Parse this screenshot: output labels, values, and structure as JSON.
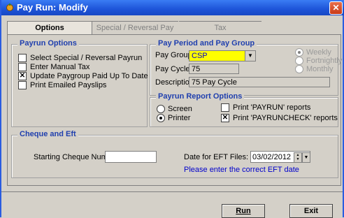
{
  "window": {
    "title": "Pay Run: Modify",
    "close_label": "✕"
  },
  "tabs": [
    {
      "label": "Options",
      "active": true
    },
    {
      "label": "Special / Reversal Pay",
      "active": false
    },
    {
      "label": "Tax",
      "active": false
    }
  ],
  "payrun_options": {
    "legend": "Payrun Options",
    "items": [
      {
        "label": "Select Special / Reversal Payrun",
        "checked": false
      },
      {
        "label": "Enter Manual Tax",
        "checked": false
      },
      {
        "label": "Update Paygroup Paid Up To Date",
        "checked": true
      },
      {
        "label": "Print Emailed Payslips",
        "checked": false
      }
    ]
  },
  "pay_period": {
    "legend": "Pay Period and Pay Group",
    "pay_group_label": "Pay Group:",
    "pay_group_value": "CSP",
    "pay_cycle_label": "Pay Cycle:",
    "pay_cycle_value": "75",
    "description_label": "Description:",
    "description_value": "75 Pay Cycle",
    "frequency": [
      {
        "label": "Weekly",
        "selected": true
      },
      {
        "label": "Fortnightly",
        "selected": false
      },
      {
        "label": "Monthly",
        "selected": false
      }
    ]
  },
  "report_options": {
    "legend": "Payrun Report Options",
    "outputs": [
      {
        "label": "Screen",
        "selected": false
      },
      {
        "label": "Printer",
        "selected": true
      }
    ],
    "reports": [
      {
        "label": "Print 'PAYRUN' reports",
        "checked": false
      },
      {
        "label": "Print 'PAYRUNCHECK' reports",
        "checked": true
      }
    ]
  },
  "cheque": {
    "legend": "Cheque and Eft",
    "starting_cheque_label": "Starting Cheque Number:",
    "starting_cheque_value": "",
    "eft_date_label": "Date for EFT Files:",
    "eft_date_value": "03/02/2012",
    "eft_note": "Please enter the correct EFT date"
  },
  "buttons": {
    "run": "Run",
    "exit": "Exit"
  },
  "colors": {
    "title_bar": "#1d54d8",
    "legend": "#1f3fae",
    "highlight": "#ffff00",
    "note": "#0000cc"
  }
}
